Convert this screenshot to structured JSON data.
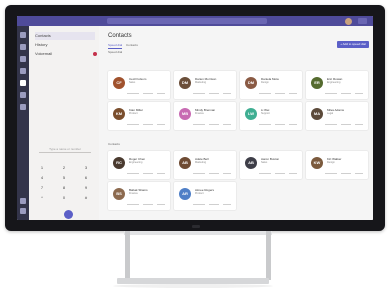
{
  "app": {
    "search_placeholder": "Search or type a command",
    "accent_color": "#5b5fc7",
    "titlebar_color": "#4f4b9a"
  },
  "rail": {
    "items": [
      {
        "icon": "bell-icon"
      },
      {
        "icon": "chat-icon"
      },
      {
        "icon": "teams-icon"
      },
      {
        "icon": "calendar-icon"
      },
      {
        "icon": "calls-icon",
        "active": true
      },
      {
        "icon": "files-icon"
      },
      {
        "icon": "more-icon"
      }
    ],
    "bottom_icons": [
      "apps-icon",
      "help-icon"
    ]
  },
  "calls_panel": {
    "items": [
      {
        "label": "Contacts",
        "active": true
      },
      {
        "label": "History"
      },
      {
        "label": "Voicemail",
        "badge": true
      }
    ],
    "dial_placeholder": "Type a name or number",
    "keypad": [
      "1",
      "2",
      "3",
      "4",
      "5",
      "6",
      "7",
      "8",
      "9",
      "*",
      "0",
      "#"
    ],
    "call_button_icon": "phone-icon"
  },
  "main": {
    "heading": "Contacts",
    "tabs": [
      "Speed dial",
      "Contacts"
    ],
    "add_button_label": "+ Add to speed dial",
    "section_speed_dial": "Speed dial",
    "section_contacts": "Contacts",
    "speed_dial": [
      {
        "name": "Cecil Folsom",
        "title": "Sales",
        "initials": "CF",
        "color": "#a0522d"
      },
      {
        "name": "Darien Morrison",
        "title": "Marketing",
        "initials": "DM",
        "color": "#6b4f3a"
      },
      {
        "name": "Daniela Mota",
        "title": "Design",
        "initials": "DM",
        "color": "#8a5a44"
      },
      {
        "name": "Eric Rowan",
        "title": "Engineering",
        "initials": "ER",
        "color": "#556b2f"
      },
      {
        "name": "Kian Miller",
        "title": "Product",
        "initials": "KM",
        "color": "#7a4e2d"
      },
      {
        "name": "Mindy Brennan",
        "title": "Finance",
        "initials": "MB",
        "color": "#c86bb3"
      },
      {
        "name": "Li Wei",
        "title": "Support",
        "initials": "LW",
        "color": "#3fae92"
      },
      {
        "name": "Miles Adams",
        "title": "Legal",
        "initials": "MA",
        "color": "#5c4a3a"
      }
    ],
    "contacts": [
      {
        "name": "Roger Chen",
        "title": "Engineering",
        "initials": "RC",
        "color": "#4a3a2f"
      },
      {
        "name": "Adele Bell",
        "title": "Marketing",
        "initials": "AB",
        "color": "#6e4b33"
      },
      {
        "name": "Aaron Buxton",
        "title": "Sales",
        "initials": "AB",
        "color": "#3e3e48"
      },
      {
        "name": "Kiri Walker",
        "title": "Design",
        "initials": "KW",
        "color": "#7b5a3d"
      },
      {
        "name": "Babak Shams",
        "title": "Finance",
        "initials": "BS",
        "color": "#8c6a4f"
      },
      {
        "name": "Aimee Rogers",
        "title": "Product",
        "initials": "AR",
        "color": "#4f7fc7"
      }
    ]
  }
}
